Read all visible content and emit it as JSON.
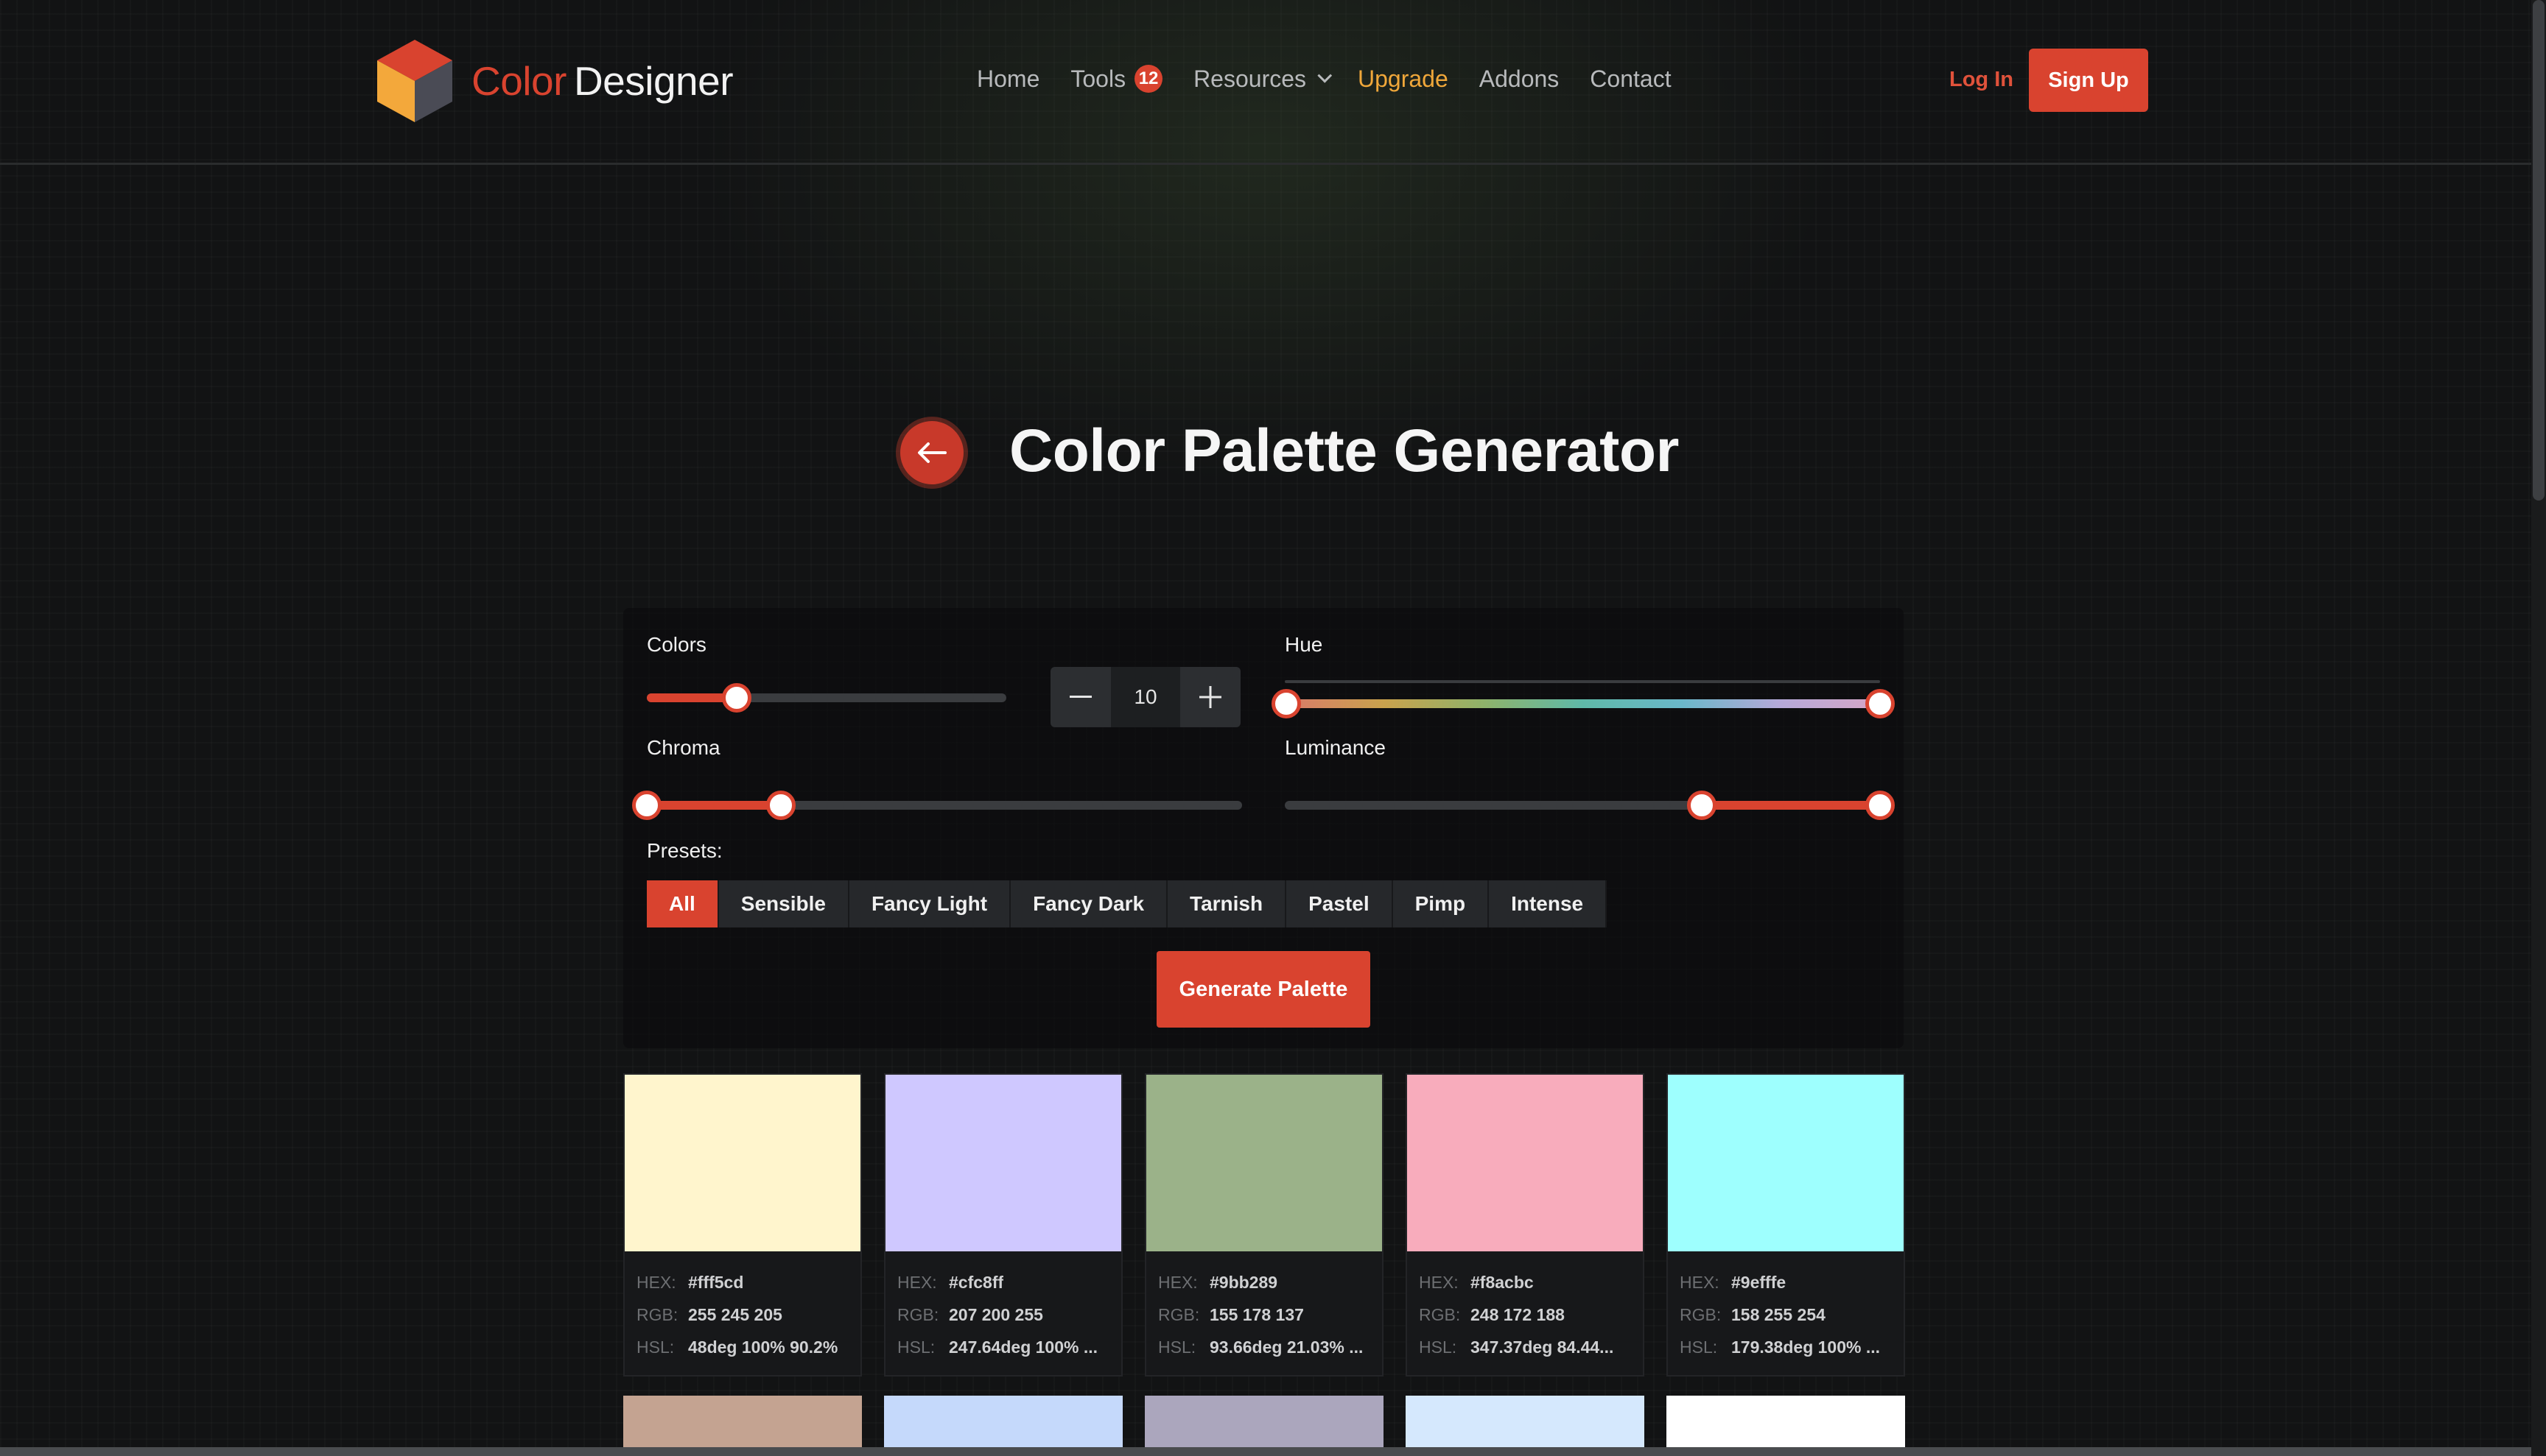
{
  "brand": {
    "word1": "Color",
    "word2": "Designer",
    "colors": {
      "accent": "#d9432f",
      "upgrade": "#f0a73a"
    }
  },
  "nav": {
    "home": "Home",
    "tools": "Tools",
    "tools_badge": "12",
    "resources": "Resources",
    "upgrade": "Upgrade",
    "addons": "Addons",
    "contact": "Contact"
  },
  "auth": {
    "login": "Log In",
    "signup": "Sign Up"
  },
  "page": {
    "title": "Color Palette Generator",
    "back_icon": "arrow-left-icon"
  },
  "controls": {
    "colors_label": "Colors",
    "colors_value": "10",
    "colors_fraction": 0.25,
    "hue_label": "Hue",
    "hue_range": [
      0,
      1
    ],
    "chroma_label": "Chroma",
    "chroma_range": [
      0,
      0.22
    ],
    "luminance_label": "Luminance",
    "luminance_range": [
      0.7,
      1
    ],
    "presets_label": "Presets:",
    "presets": [
      "All",
      "Sensible",
      "Fancy Light",
      "Fancy Dark",
      "Tarnish",
      "Pastel",
      "Pimp",
      "Intense"
    ],
    "active_preset": "All",
    "generate": "Generate Palette"
  },
  "labels": {
    "hex": "HEX:",
    "rgb": "RGB:",
    "hsl": "HSL:"
  },
  "swatches": [
    {
      "color": "#fff5cd",
      "hex": "#fff5cd",
      "rgb": "255 245 205",
      "hsl": "48deg 100% 90.2%"
    },
    {
      "color": "#cfc8ff",
      "hex": "#cfc8ff",
      "rgb": "207 200 255",
      "hsl": "247.64deg 100% ..."
    },
    {
      "color": "#9bb289",
      "hex": "#9bb289",
      "rgb": "155 178 137",
      "hsl": "93.66deg 21.03% ..."
    },
    {
      "color": "#f8acbc",
      "hex": "#f8acbc",
      "rgb": "248 172 188",
      "hsl": "347.37deg 84.44..."
    },
    {
      "color": "#9efffe",
      "hex": "#9efffe",
      "rgb": "158 255 254",
      "hsl": "179.38deg 100% ..."
    }
  ],
  "swatches_row2": [
    {
      "color": "#c4a391"
    },
    {
      "color": "#c5d9fb"
    },
    {
      "color": "#aba6bd"
    },
    {
      "color": "#d5e8fd"
    },
    {
      "color": "#ffffff"
    }
  ]
}
